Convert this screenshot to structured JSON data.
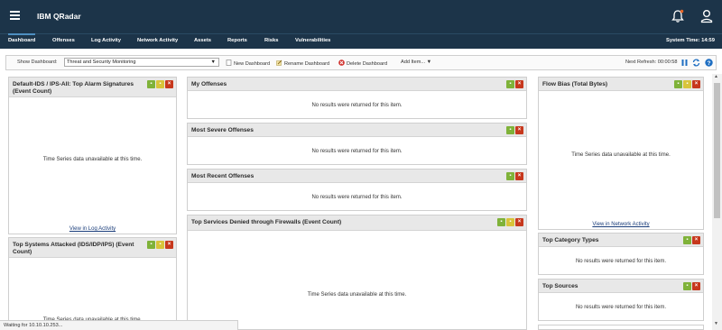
{
  "app": {
    "title": "IBM QRadar"
  },
  "nav": {
    "tabs": [
      {
        "label": "Dashboard"
      },
      {
        "label": "Offenses"
      },
      {
        "label": "Log Activity"
      },
      {
        "label": "Network Activity"
      },
      {
        "label": "Assets"
      },
      {
        "label": "Reports"
      },
      {
        "label": "Risks"
      },
      {
        "label": "Vulnerabilities"
      }
    ],
    "system_time": "System Time: 14:59"
  },
  "toolbar": {
    "show_dashboard_label": "Show Dashboard:",
    "selected_dashboard": "Threat and Security Monitoring",
    "new_dashboard": "New Dashboard",
    "rename_dashboard": "Rename Dashboard",
    "delete_dashboard": "Delete Dashboard",
    "add_item": "Add Item...",
    "next_refresh": "Next Refresh: 00:00:58"
  },
  "panels": {
    "alarm": {
      "title": "Default-IDS / IPS-All: Top Alarm Signatures (Event Count)",
      "message": "Time Series data unavailable at this time.",
      "link": "View in Log Activity"
    },
    "systems_attacked": {
      "title": "Top Systems Attacked (IDS/IDP/IPS) (Event Count)",
      "message": "Time Series data unavailable at this time."
    },
    "my_offenses": {
      "title": "My Offenses",
      "message": "No results were returned for this item."
    },
    "severe": {
      "title": "Most Severe Offenses",
      "message": "No results were returned for this item."
    },
    "recent": {
      "title": "Most Recent Offenses",
      "message": "No results were returned for this item."
    },
    "denied": {
      "title": "Top Services Denied through Firewalls (Event Count)",
      "message": "Time Series data unavailable at this time."
    },
    "flow_bias": {
      "title": "Flow Bias (Total Bytes)",
      "message": "Time Series data unavailable at this time.",
      "link": "View in Network Activity"
    },
    "category": {
      "title": "Top Category Types",
      "message": "No results were returned for this item."
    },
    "sources": {
      "title": "Top Sources",
      "message": "No results were returned for this item."
    }
  },
  "status": {
    "text": "Waiting for 10.10.10.253..."
  },
  "colors": {
    "topbar": "#1c3449",
    "panel_header": "#e8e8e8",
    "icon_green": "#7fb239",
    "icon_yellow": "#d8c43a",
    "icon_red": "#c7381d",
    "link": "#1a3d7a"
  }
}
